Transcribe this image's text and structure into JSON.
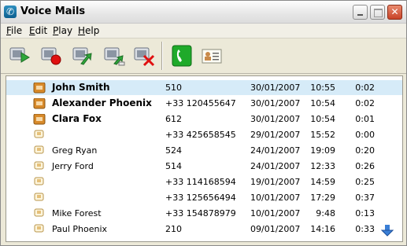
{
  "window": {
    "title": "Voice Mails"
  },
  "menu": [
    {
      "label": "File",
      "u": "F",
      "rest": "ile"
    },
    {
      "label": "Edit",
      "u": "E",
      "rest": "dit"
    },
    {
      "label": "Play",
      "u": "P",
      "rest": "lay"
    },
    {
      "label": "Help",
      "u": "H",
      "rest": "elp"
    }
  ],
  "toolbar": {
    "buttons": [
      "play-icon",
      "record-icon",
      "forward-icon",
      "forward-to-icon",
      "delete-icon",
      "call-icon",
      "contact-card-icon"
    ]
  },
  "colors": {
    "selected_row": "#d6ebf8",
    "unread_icon": "#d88a2a",
    "read_icon": "#e5c07a"
  },
  "voicemails": [
    {
      "name": "John Smith",
      "number": "510",
      "date": "30/01/2007",
      "time": "10:55",
      "duration": "0:02",
      "unread": true,
      "selected": true
    },
    {
      "name": "Alexander Phoenix",
      "number": "+33 120455647",
      "date": "30/01/2007",
      "time": "10:54",
      "duration": "0:02",
      "unread": true,
      "selected": false
    },
    {
      "name": "Clara Fox",
      "number": "612",
      "date": "30/01/2007",
      "time": "10:54",
      "duration": "0:01",
      "unread": true,
      "selected": false
    },
    {
      "name": "",
      "number": "+33 425658545",
      "date": "29/01/2007",
      "time": "15:52",
      "duration": "0:00",
      "unread": false,
      "selected": false
    },
    {
      "name": "Greg Ryan",
      "number": "524",
      "date": "24/01/2007",
      "time": "19:09",
      "duration": "0:20",
      "unread": false,
      "selected": false
    },
    {
      "name": "Jerry Ford",
      "number": "514",
      "date": "24/01/2007",
      "time": "12:33",
      "duration": "0:26",
      "unread": false,
      "selected": false
    },
    {
      "name": "",
      "number": "+33 114168594",
      "date": "19/01/2007",
      "time": "14:59",
      "duration": "0:25",
      "unread": false,
      "selected": false
    },
    {
      "name": "",
      "number": "+33 125656494",
      "date": "10/01/2007",
      "time": "17:29",
      "duration": "0:37",
      "unread": false,
      "selected": false
    },
    {
      "name": "Mike Forest",
      "number": "+33 154878979",
      "date": "10/01/2007",
      "time": "9:48",
      "duration": "0:13",
      "unread": false,
      "selected": false
    },
    {
      "name": "Paul Phoenix",
      "number": "210",
      "date": "09/01/2007",
      "time": "14:16",
      "duration": "0:33",
      "unread": false,
      "selected": false
    }
  ]
}
